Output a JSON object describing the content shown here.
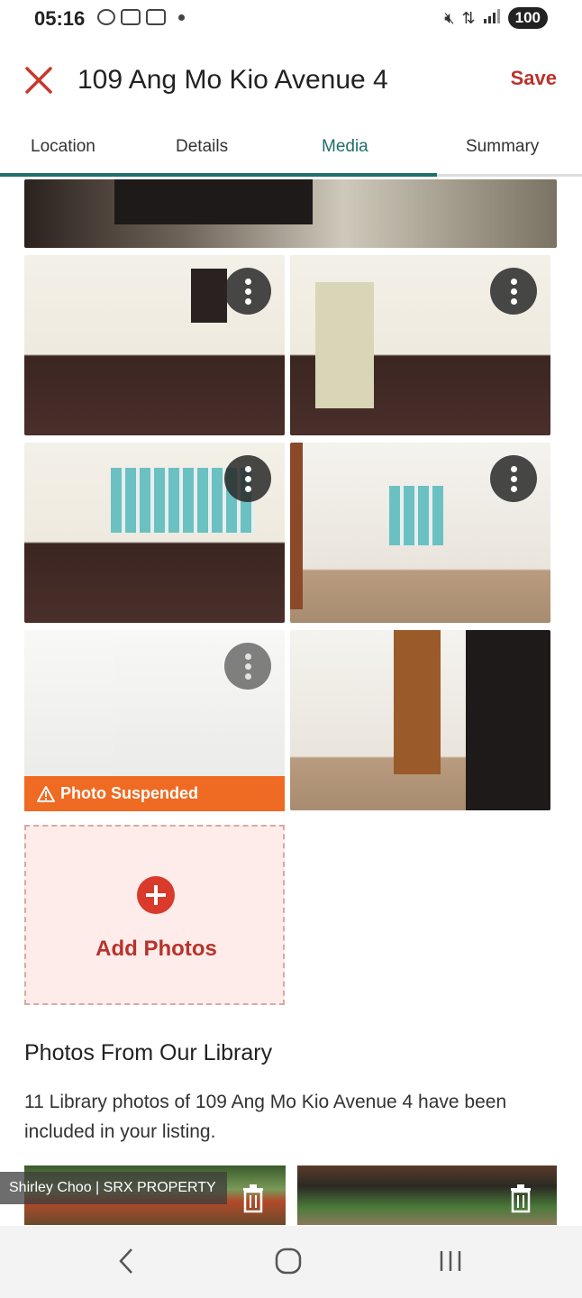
{
  "status_bar": {
    "time": "05:16",
    "battery": "100",
    "icons": [
      "screenshot-icon",
      "gallery-icon",
      "gallery-icon",
      "dot-icon",
      "mute-icon",
      "data-icon",
      "signal-icon"
    ]
  },
  "header": {
    "title": "109 Ang Mo Kio Avenue 4",
    "save_label": "Save",
    "close_icon": "close-icon"
  },
  "tabs": [
    {
      "label": "Location",
      "active": false
    },
    {
      "label": "Details",
      "active": false
    },
    {
      "label": "Media",
      "active": true
    },
    {
      "label": "Summary",
      "active": false
    }
  ],
  "tab_progress_fraction": 0.75,
  "photos": {
    "suspended_label": "Photo Suspended",
    "add_photos_label": "Add Photos"
  },
  "library": {
    "title": "Photos From Our Library",
    "description": "11 Library photos of 109 Ang Mo Kio Avenue 4 have been included in your listing.",
    "watermark": "Shirley Choo | SRX PROPERTY"
  },
  "colors": {
    "accent": "#1f6f6a",
    "brand_red": "#b8332b",
    "warning_orange": "#ef6a22",
    "add_bg": "#fdecea"
  }
}
